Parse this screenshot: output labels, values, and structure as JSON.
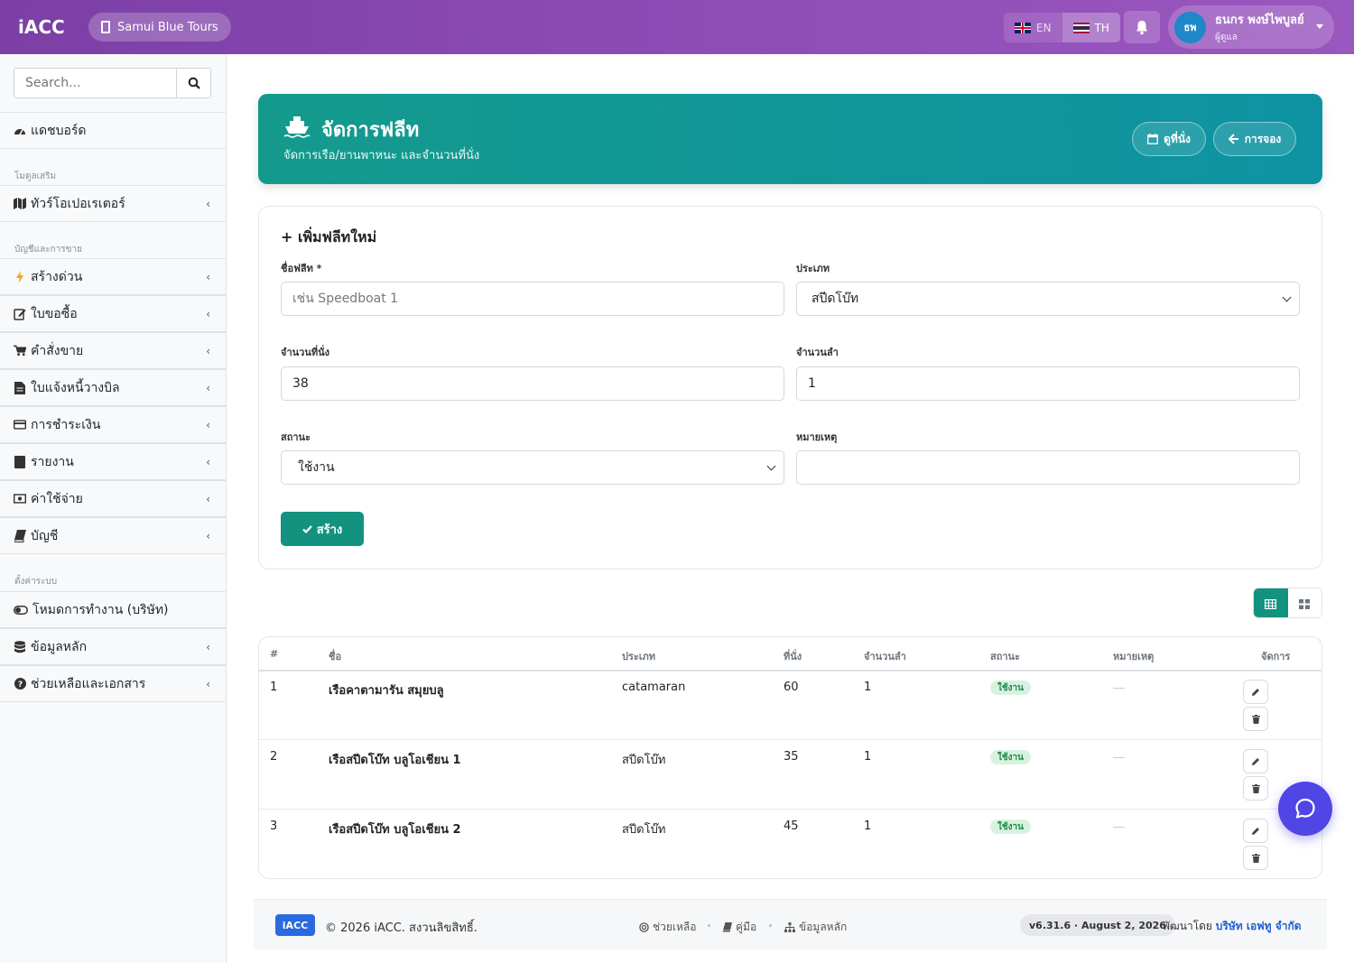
{
  "app": {
    "brand": "iACC",
    "company": "Samui Blue Tours"
  },
  "topbar": {
    "lang_en": "EN",
    "lang_th": "TH",
    "user_initials": "ธพ",
    "user_name": "ธนกร พงษ์ไพบูลย์",
    "user_role": "ผู้ดูแล"
  },
  "sidebar": {
    "search_placeholder": "Search...",
    "dashboard": "แดชบอร์ด",
    "section_modules": "โมดูลเสริม",
    "tour_operator": "ทัวร์โอเปอเรเตอร์",
    "section_accounts": "บัญชีและการขาย",
    "items": [
      {
        "label": "สร้างด่วน",
        "icon": "bolt-icon"
      },
      {
        "label": "ใบขอซื้อ",
        "icon": "edit-icon"
      },
      {
        "label": "คำสั่งขาย",
        "icon": "cart-icon"
      },
      {
        "label": "ใบแจ้งหนี้วางบิล",
        "icon": "file-icon"
      },
      {
        "label": "การชำระเงิน",
        "icon": "credit-card-icon"
      },
      {
        "label": "รายงาน",
        "icon": "book-icon"
      },
      {
        "label": "ค่าใช้จ่าย",
        "icon": "money-icon"
      },
      {
        "label": "บัญชี",
        "icon": "ledger-icon"
      }
    ],
    "section_settings": "ตั้งค่าระบบ",
    "work_mode": "โหมดการทำงาน (บริษัท)",
    "master_data": "ข้อมูลหลัก",
    "help_docs": "ช่วยเหลือและเอกสาร"
  },
  "hero": {
    "title": "จัดการฟลีท",
    "subtitle": "จัดการเรือ/ยานพาหนะ และจำนวนที่นั่ง",
    "seats_button": "ดูที่นั่ง",
    "back_button": "การจอง"
  },
  "form": {
    "title": "เพิ่มฟลีทใหม่",
    "name_label": "ชื่อฟลีท *",
    "name_placeholder": "เช่น Speedboat 1",
    "type_label": "ประเภท",
    "type_value": "สปีดโบ๊ท",
    "seats_label": "จำนวนที่นั่ง",
    "seats_value": "38",
    "count_label": "จำนวนลำ",
    "count_value": "1",
    "status_label": "สถานะ",
    "status_value": "ใช้งาน",
    "note_label": "หมายเหตุ",
    "note_value": "",
    "submit_label": "สร้าง"
  },
  "table": {
    "columns": [
      "#",
      "ชื่อ",
      "ประเภท",
      "ที่นั่ง",
      "จำนวนลำ",
      "สถานะ",
      "หมายเหตุ",
      "จัดการ"
    ],
    "rows": [
      {
        "no": "1",
        "name": "เรือคาตามารัน สมุยบลู",
        "type": "catamaran",
        "seats": "60",
        "count": "1",
        "status": "ใช้งาน"
      },
      {
        "no": "2",
        "name": "เรือสปีดโบ๊ท บลูโอเชียน 1",
        "type": "สปีดโบ๊ท",
        "seats": "35",
        "count": "1",
        "status": "ใช้งาน"
      },
      {
        "no": "3",
        "name": "เรือสปีดโบ๊ท บลูโอเชียน 2",
        "type": "สปีดโบ๊ท",
        "seats": "45",
        "count": "1",
        "status": "ใช้งาน"
      }
    ]
  },
  "footer": {
    "logo": "iACC",
    "copyright": "© 2026 iACC. สงวนลิขสิทธิ์.",
    "help": "ช่วยเหลือ",
    "manual": "คู่มือ",
    "master_data": "ข้อมูลหลัก",
    "version": "v6.31.6 · August 2, 2026",
    "developed_by": "พัฒนาโดย",
    "developer": "บริษัท เอฟทู จำกัด"
  },
  "colors": {
    "topbar": "#8e4bb6",
    "hero": "#12927f",
    "accent": "#12927f",
    "chat": "#4f46e5"
  }
}
